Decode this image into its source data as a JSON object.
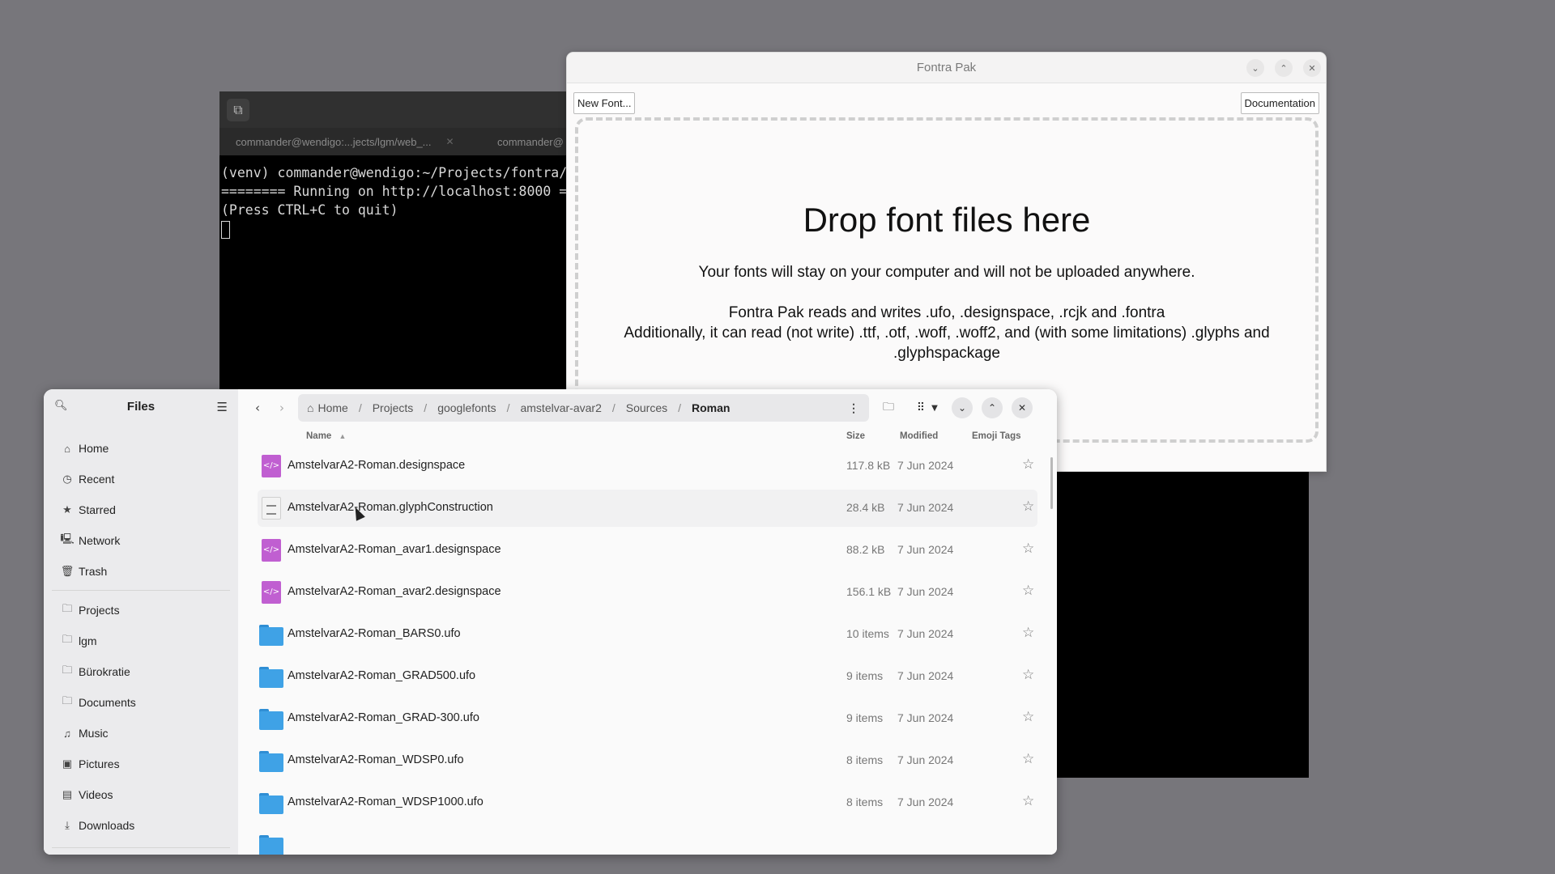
{
  "terminal": {
    "tabs": [
      {
        "label": "commander@wendigo:...jects/lgm/web_..."
      },
      {
        "label": "commander@"
      }
    ],
    "lines": [
      "(venv) commander@wendigo:~/Projects/fontra/",
      "======== Running on http://localhost:8000 =",
      "(Press CTRL+C to quit)"
    ]
  },
  "fontra": {
    "title": "Fontra Pak",
    "new_font_label": "New Font...",
    "documentation_label": "Documentation",
    "drop_title": "Drop font files here",
    "line1": "Your fonts will stay on your computer and will not be uploaded anywhere.",
    "line2": "Fontra Pak reads and writes .ufo, .designspace, .rcjk and .fontra",
    "line3": "Additionally, it can read (not write) .ttf, .otf, .woff, .woff2, and (with some limitations) .glyphs and",
    "line4": ".glyphspackage"
  },
  "files": {
    "title": "Files",
    "sidebar": {
      "places": [
        {
          "label": "Home",
          "icon": "home-icon"
        },
        {
          "label": "Recent",
          "icon": "clock-icon"
        },
        {
          "label": "Starred",
          "icon": "star-icon"
        },
        {
          "label": "Network",
          "icon": "network-icon"
        },
        {
          "label": "Trash",
          "icon": "trash-icon"
        }
      ],
      "bookmarks": [
        {
          "label": "Projects",
          "icon": "folder-icon"
        },
        {
          "label": "lgm",
          "icon": "folder-icon"
        },
        {
          "label": "Bürokratie",
          "icon": "folder-icon"
        },
        {
          "label": "Documents",
          "icon": "documents-icon"
        },
        {
          "label": "Music",
          "icon": "music-icon"
        },
        {
          "label": "Pictures",
          "icon": "pictures-icon"
        },
        {
          "label": "Videos",
          "icon": "videos-icon"
        },
        {
          "label": "Downloads",
          "icon": "downloads-icon"
        }
      ]
    },
    "path": [
      "Home",
      "Projects",
      "googlefonts",
      "amstelvar-avar2",
      "Sources",
      "Roman"
    ],
    "columns": {
      "name": "Name",
      "size": "Size",
      "modified": "Modified",
      "tags": "Emoji Tags"
    },
    "rows": [
      {
        "name": "AmstelvarA2-Roman.designspace",
        "size": "117.8 kB",
        "modified": "7 Jun 2024",
        "type": "code"
      },
      {
        "name": "AmstelvarA2-Roman.glyphConstruction",
        "size": "28.4 kB",
        "modified": "7 Jun 2024",
        "type": "text"
      },
      {
        "name": "AmstelvarA2-Roman_avar1.designspace",
        "size": "88.2 kB",
        "modified": "7 Jun 2024",
        "type": "code"
      },
      {
        "name": "AmstelvarA2-Roman_avar2.designspace",
        "size": "156.1 kB",
        "modified": "7 Jun 2024",
        "type": "code"
      },
      {
        "name": "AmstelvarA2-Roman_BARS0.ufo",
        "size": "10 items",
        "modified": "7 Jun 2024",
        "type": "folder"
      },
      {
        "name": "AmstelvarA2-Roman_GRAD500.ufo",
        "size": "9 items",
        "modified": "7 Jun 2024",
        "type": "folder"
      },
      {
        "name": "AmstelvarA2-Roman_GRAD-300.ufo",
        "size": "9 items",
        "modified": "7 Jun 2024",
        "type": "folder"
      },
      {
        "name": "AmstelvarA2-Roman_WDSP0.ufo",
        "size": "8 items",
        "modified": "7 Jun 2024",
        "type": "folder"
      },
      {
        "name": "AmstelvarA2-Roman_WDSP1000.ufo",
        "size": "8 items",
        "modified": "7 Jun 2024",
        "type": "folder"
      }
    ]
  }
}
